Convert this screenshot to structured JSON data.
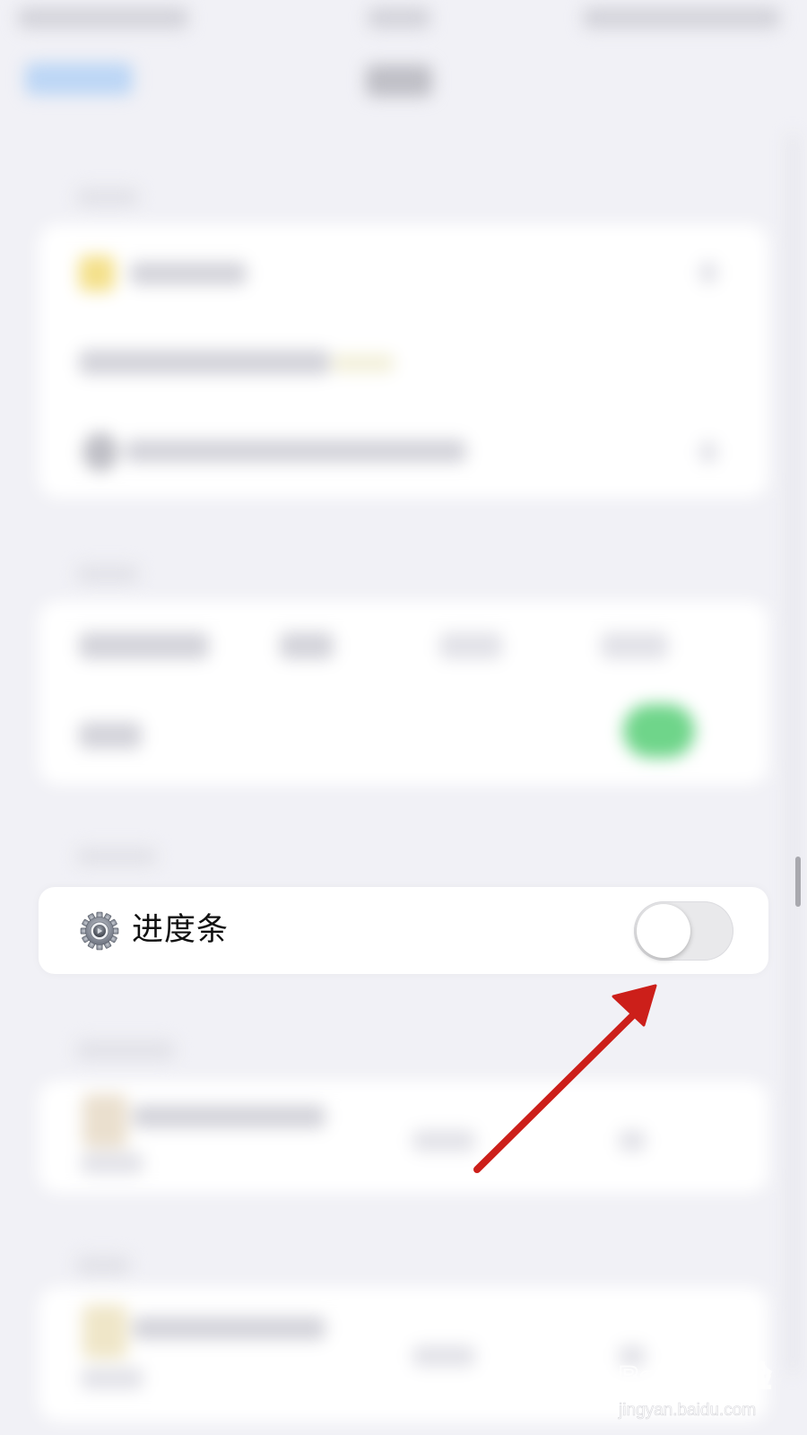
{
  "settings_row": {
    "icon": "gear-icon",
    "label": "进度条",
    "toggle_on": false
  },
  "colors": {
    "background": "#f1f1f6",
    "toggle_off": "#e9e9eb",
    "blurred_toggle_on": "#6fd58a",
    "annotation_arrow": "#cc1f1a"
  },
  "watermark": {
    "logo_text": "Baidu经验",
    "url": "jingyan.baidu.com"
  }
}
